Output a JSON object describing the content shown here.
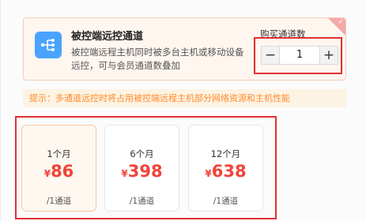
{
  "service": {
    "title": "被控端远控通道",
    "description": "被控端远程主机同时被多台主机或移动设备远控，可与会员通道数叠加",
    "quantity_label": "购买通道数",
    "quantity_value": "1",
    "minus_symbol": "−",
    "plus_symbol": "+",
    "icon": "network-branch-icon",
    "corner_badge": "✓"
  },
  "notice": {
    "text": "提示：多通道远控时将占用被控端远程主机部分网络资源和主机性能"
  },
  "plans": [
    {
      "period": "1个月",
      "currency": "¥",
      "price": "86",
      "unit": "/1通道",
      "selected": true
    },
    {
      "period": "6个月",
      "currency": "¥",
      "price": "398",
      "unit": "/1通道",
      "selected": false
    },
    {
      "period": "12个月",
      "currency": "¥",
      "price": "638",
      "unit": "/1通道",
      "selected": false
    }
  ],
  "colors": {
    "accent": "#f0443a",
    "notice_text": "#ff8a2a",
    "icon_bg": "#4aa3ff",
    "highlight_box": "#e03030"
  }
}
